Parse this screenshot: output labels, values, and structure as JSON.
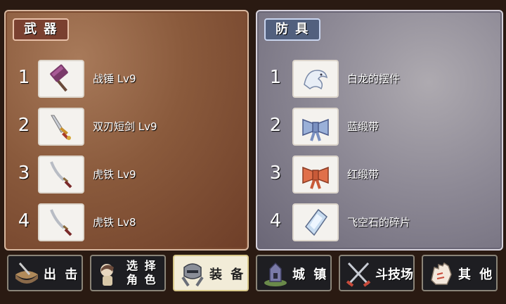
{
  "weapons": {
    "title": "武 器",
    "items": [
      {
        "num": "1",
        "name": "战锤 Lv9",
        "icon": "war-hammer-icon"
      },
      {
        "num": "2",
        "name": "双刃短剑 Lv9",
        "icon": "dagger-icon"
      },
      {
        "num": "3",
        "name": "虎铁 Lv9",
        "icon": "katana-icon"
      },
      {
        "num": "4",
        "name": "虎铁 Lv8",
        "icon": "katana-icon"
      }
    ]
  },
  "armor": {
    "title": "防 具",
    "items": [
      {
        "num": "1",
        "name": "白龙的摆件",
        "icon": "white-dragon-ornament-icon"
      },
      {
        "num": "2",
        "name": "蓝缎带",
        "icon": "blue-ribbon-icon"
      },
      {
        "num": "3",
        "name": "红缎带",
        "icon": "red-ribbon-icon"
      },
      {
        "num": "4",
        "name": "飞空石的碎片",
        "icon": "crystal-shard-icon"
      }
    ]
  },
  "nav": [
    {
      "label": "出 击",
      "icon": "sortie-icon",
      "active": false
    },
    {
      "label_line1": "选 择",
      "label_line2": "角 色",
      "icon": "select-character-icon",
      "active": false
    },
    {
      "label": "装 备",
      "icon": "equipment-icon",
      "active": true
    },
    {
      "label": "城 镇",
      "icon": "town-icon",
      "active": false
    },
    {
      "label": "斗技场",
      "icon": "arena-icon",
      "active": false
    },
    {
      "label": "其 他",
      "icon": "other-icon",
      "active": false
    }
  ],
  "colors": {
    "weapons_panel": "#8a5a3c",
    "armor_panel": "#8e8a96",
    "active_nav": "#f2ecd8"
  }
}
